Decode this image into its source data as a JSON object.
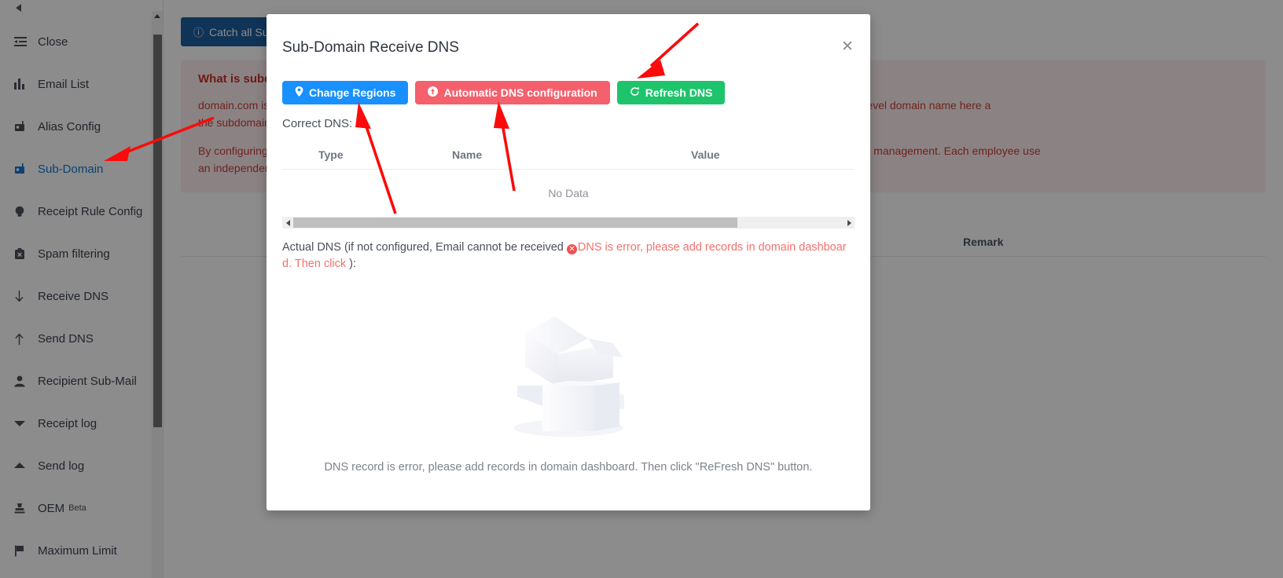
{
  "sidebar": {
    "collapse_icon": "collapse-left-arrow",
    "items": [
      {
        "label": "Close",
        "icon": "list-indent-icon",
        "active": false
      },
      {
        "label": "Email List",
        "icon": "bar-chart-icon",
        "active": false
      },
      {
        "label": "Alias Config",
        "icon": "mailbox-icon",
        "active": false
      },
      {
        "label": "Sub-Domain",
        "icon": "mailbox-icon",
        "active": true
      },
      {
        "label": "Receipt Rule Config",
        "icon": "lightbulb-icon",
        "active": false
      },
      {
        "label": "Spam filtering",
        "icon": "clipboard-x-icon",
        "active": false
      },
      {
        "label": "Receive DNS",
        "icon": "arrow-down-icon",
        "active": false
      },
      {
        "label": "Send DNS",
        "icon": "arrow-up-icon",
        "active": false
      },
      {
        "label": "Recipient Sub-Mail",
        "icon": "user-icon",
        "active": false
      },
      {
        "label": "Receipt log",
        "icon": "caret-down-icon",
        "active": false
      },
      {
        "label": "Send log",
        "icon": "caret-up-icon",
        "active": false
      },
      {
        "label": "OEM",
        "icon": "stamp-icon",
        "active": false,
        "sup": "Beta"
      },
      {
        "label": "Maximum Limit",
        "icon": "flag-icon",
        "active": false
      }
    ]
  },
  "page": {
    "catch_all_button": "Catch all Sub-Domain Email",
    "catch_all_icon": "info-circle-icon",
    "info": {
      "title": "What is subdomain?",
      "paragraph1_line1": "domain.com is the top-level domain name, mail.domain.com is the second-level domain name. The second-level domain name and third-level domain name here a",
      "paragraph1_line2": "the subdomain.",
      "paragraph2_line1": "By configuring the subdomain, each department can use an independent domain name, which is very convenient for employee permission management. Each employee use",
      "paragraph2_line2": "an independent domain name."
    },
    "table_headers": [
      "Remark"
    ]
  },
  "modal": {
    "title": "Sub-Domain Receive DNS",
    "close_icon": "close-icon",
    "buttons": [
      {
        "label": "Change Regions",
        "icon": "location-pin-icon",
        "color": "#1890ff"
      },
      {
        "label": "Automatic DNS configuration",
        "icon": "plus-circle-icon",
        "color": "#f4606c"
      },
      {
        "label": "Refresh DNS",
        "icon": "refresh-icon",
        "color": "#1ec46b"
      }
    ],
    "correct_dns_label": "Correct DNS:",
    "table": {
      "headers": [
        "Type",
        "Name",
        "Value"
      ],
      "no_data_text": "No Data",
      "rows": []
    },
    "scrollbar": {
      "left_icon": "scroll-left-arrow",
      "right_icon": "scroll-right-arrow"
    },
    "actual_dns": {
      "prefix": "Actual DNS (if not configured, Email cannot be received ",
      "error_icon": "error-circle-icon",
      "error_text": "DNS is error, please add records in domain dashboard. Then click",
      "suffix": " ):"
    },
    "empty_state": {
      "illustration": "empty-box-illustration",
      "message": "DNS record is error, please add records in domain dashboard. Then click \"ReFresh DNS\" button."
    }
  },
  "annotations": {
    "arrow_color": "#fb0b0b",
    "arrows": [
      {
        "name": "arrow-to-sub-domain-menu"
      },
      {
        "name": "arrow-to-change-regions-button"
      },
      {
        "name": "arrow-to-automatic-dns-button"
      },
      {
        "name": "arrow-to-refresh-dns-button"
      }
    ]
  }
}
